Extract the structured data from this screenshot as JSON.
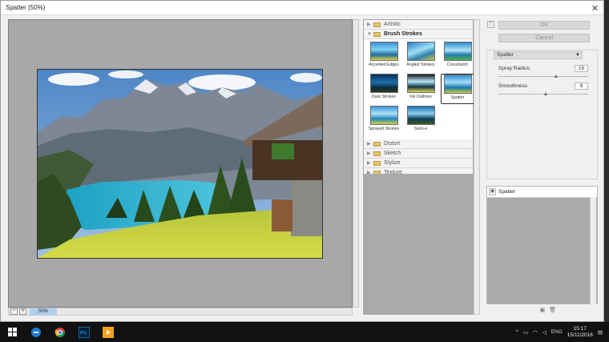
{
  "window": {
    "title": "Spatter (50%)"
  },
  "preview": {
    "zoom": "50%"
  },
  "gallery": {
    "categories_top": [
      {
        "label": "Artistic"
      },
      {
        "label": "Brush Strokes"
      }
    ],
    "thumbnails": [
      {
        "label": "Accented Edges"
      },
      {
        "label": "Angled Strokes"
      },
      {
        "label": "Crosshatch"
      },
      {
        "label": "Dark Strokes"
      },
      {
        "label": "Ink Outlines"
      },
      {
        "label": "Spatter"
      },
      {
        "label": "Sprayed Strokes"
      },
      {
        "label": "Sumi-e"
      }
    ],
    "categories_bottom": [
      {
        "label": "Distort"
      },
      {
        "label": "Sketch"
      },
      {
        "label": "Stylize"
      },
      {
        "label": "Texture"
      }
    ],
    "selected": "Spatter"
  },
  "buttons": {
    "ok": "OK",
    "cancel": "Cancel"
  },
  "settings": {
    "filter": "Spatter",
    "spray_radius": {
      "label": "Spray Radius",
      "value": "16",
      "slider_fraction": 0.64
    },
    "smoothness": {
      "label": "Smoothness",
      "value": "8",
      "slider_fraction": 0.53
    }
  },
  "layers": {
    "items": [
      {
        "name": "Spatter"
      }
    ]
  },
  "taskbar": {
    "lang": "ENG",
    "time": "15:17",
    "date": "15/11/2016"
  },
  "colors": {
    "accent": "#aecfee",
    "taskbar": "#111111",
    "photoshop": "#001e36"
  }
}
